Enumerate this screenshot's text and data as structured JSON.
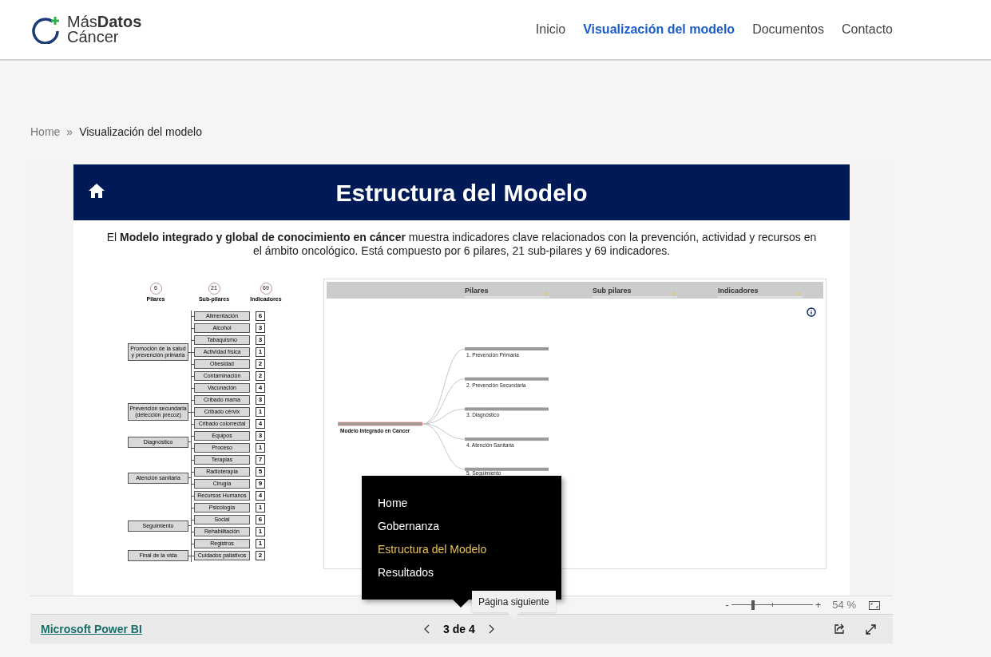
{
  "header": {
    "logo": {
      "line_1": "Más**Datos**",
      "line_2": "Cáncer"
    },
    "nav": [
      {
        "label": "Inicio",
        "selected": false
      },
      {
        "label": "Visualización del modelo",
        "selected": true
      },
      {
        "label": "Documentos",
        "selected": false
      },
      {
        "label": "Contacto",
        "selected": false
      }
    ]
  },
  "breadcrumb": {
    "items": [
      "Home",
      "Visualización del modelo"
    ],
    "separator": "»"
  },
  "report": {
    "title": "Estructura del Modelo",
    "description": "El **Modelo integrado y global de conocimiento en cáncer** muestra indicadores clave relacionados con la prevención, actividad y recursos en el ámbito oncológico. Está compuesto por 6 pilares, 21 sub-pilares y 69 indicadores.",
    "diagram": {
      "headers": [
        {
          "count": "6",
          "label": "Pilares"
        },
        {
          "count": "21",
          "label": "Sub-pilares"
        },
        {
          "count": "69",
          "label": "Indicadores"
        }
      ],
      "groups": [
        {
          "pillar": "Promoción de la salud y prevención primaria",
          "subs": [
            {
              "name": "Alimentación",
              "count": "6"
            },
            {
              "name": "Alcohol",
              "count": "3"
            },
            {
              "name": "Tabaquismo",
              "count": "3"
            },
            {
              "name": "Actividad física",
              "count": "1"
            },
            {
              "name": "Obesidad",
              "count": "2"
            },
            {
              "name": "Contaminación",
              "count": "2"
            },
            {
              "name": "Vacunación",
              "count": "4"
            }
          ]
        },
        {
          "pillar": "Prevención secundaria (detección precoz)",
          "subs": [
            {
              "name": "Cribado mama",
              "count": "3"
            },
            {
              "name": "Cribado cérvix",
              "count": "1"
            },
            {
              "name": "Cribado colorrectal",
              "count": "4"
            }
          ]
        },
        {
          "pillar": "Diagnóstico",
          "subs": [
            {
              "name": "Equipos",
              "count": "3"
            },
            {
              "name": "Proceso",
              "count": "1"
            }
          ]
        },
        {
          "pillar": "Atención sanitaria",
          "subs": [
            {
              "name": "Terapias",
              "count": "7"
            },
            {
              "name": "Radioterapia",
              "count": "5"
            },
            {
              "name": "Cirugía",
              "count": "9"
            },
            {
              "name": "Recursos Humanos",
              "count": "4"
            }
          ]
        },
        {
          "pillar": "Seguimiento",
          "subs": [
            {
              "name": "Psicología",
              "count": "1"
            },
            {
              "name": "Social",
              "count": "6"
            },
            {
              "name": "Rehabilitación",
              "count": "1"
            },
            {
              "name": "Registros",
              "count": "1"
            }
          ]
        },
        {
          "pillar": "Final de la vida",
          "subs": [
            {
              "name": "Cuidados paliativos",
              "count": "2"
            }
          ]
        }
      ]
    },
    "visual": {
      "slicers": [
        "Pilares",
        "Sub pilares",
        "Indicadores"
      ],
      "tree": {
        "root": "Modelo Integrado en Cancer",
        "children": [
          "1. Prevención Primaria",
          "2. Prevención Secundaria",
          "3. Diagnóstico",
          "4. Atención Sanitaria",
          "5. Seguimiento"
        ]
      }
    }
  },
  "page_menu": {
    "items": [
      {
        "label": "Home",
        "selected": false
      },
      {
        "label": "Gobernanza",
        "selected": false
      },
      {
        "label": "Estructura del Modelo",
        "selected": true
      },
      {
        "label": "Resultados",
        "selected": false
      }
    ]
  },
  "tooltip": "Página siguiente",
  "zoom": {
    "minus": "-",
    "plus": "+",
    "level": 0.26,
    "reading": "54 %"
  },
  "footer": {
    "link": "Microsoft Power BI",
    "page": "3 de 4"
  }
}
